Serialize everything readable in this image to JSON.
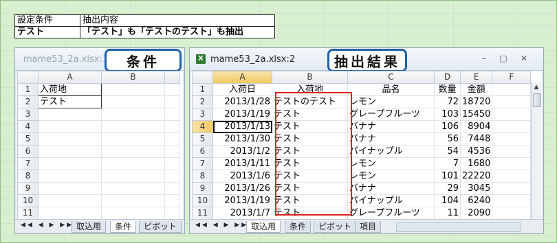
{
  "criteria_table": {
    "header": [
      "設定条件",
      "抽出内容"
    ],
    "row": [
      "テスト",
      "「テスト」も「テストのテスト」も抽出"
    ]
  },
  "window_left": {
    "title": "mame53_2a.xlsx:1",
    "callout": "条件",
    "columns": [
      "A",
      "B"
    ],
    "rows": [
      "1",
      "2",
      "3",
      "4",
      "5",
      "6",
      "7",
      "8",
      "9",
      "10",
      "11"
    ],
    "cells": [
      [
        "入荷地",
        ""
      ],
      [
        "テスト",
        ""
      ]
    ],
    "nav": "◀◀ ◀ ▶ ▶▶",
    "tabs": [
      "取込用",
      "条件",
      "ピボット"
    ],
    "selected_tab": "条件"
  },
  "window_right": {
    "title": "mame53_2a.xlsx:2",
    "callout": "抽出結果",
    "icon": "excel-icon",
    "controls": {
      "minimize": "–",
      "restore": "▢",
      "close": "✕"
    },
    "columns": [
      "A",
      "B",
      "C",
      "D",
      "E",
      "F"
    ],
    "rows": [
      "1",
      "2",
      "3",
      "4",
      "5",
      "6",
      "7",
      "8",
      "9",
      "10",
      "11"
    ],
    "headers": [
      "入荷日",
      "入荷地",
      "品名",
      "数量",
      "金額"
    ],
    "data": [
      [
        "2013/1/28",
        "テストのテスト",
        "レモン",
        "72",
        "18720"
      ],
      [
        "2013/1/19",
        "テスト",
        "グレープフルーツ",
        "103",
        "15450"
      ],
      [
        "2013/1/13",
        "テスト",
        "バナナ",
        "106",
        "8904"
      ],
      [
        "2013/1/30",
        "テスト",
        "バナナ",
        "56",
        "7448"
      ],
      [
        "2013/1/2",
        "テスト",
        "パイナップル",
        "54",
        "4536"
      ],
      [
        "2013/1/11",
        "テスト",
        "レモン",
        "7",
        "1680"
      ],
      [
        "2013/1/6",
        "テスト",
        "レモン",
        "101",
        "22220"
      ],
      [
        "2013/1/26",
        "テスト",
        "バナナ",
        "29",
        "3045"
      ],
      [
        "2013/1/19",
        "テスト",
        "パイナップル",
        "104",
        "6240"
      ],
      [
        "2013/1/7",
        "テスト",
        "グレープフルーツ",
        "11",
        "2090"
      ]
    ],
    "nav": "◀◀ ◀ ▶ ▶▶",
    "tabs": [
      "取込用",
      "条件",
      "ピボット",
      "項目"
    ],
    "selected_tab": "取込用"
  },
  "colors": {
    "callout_border": "#1f5fa8",
    "highlight_box": "#e02020",
    "page_bg": "#d8efd0"
  }
}
